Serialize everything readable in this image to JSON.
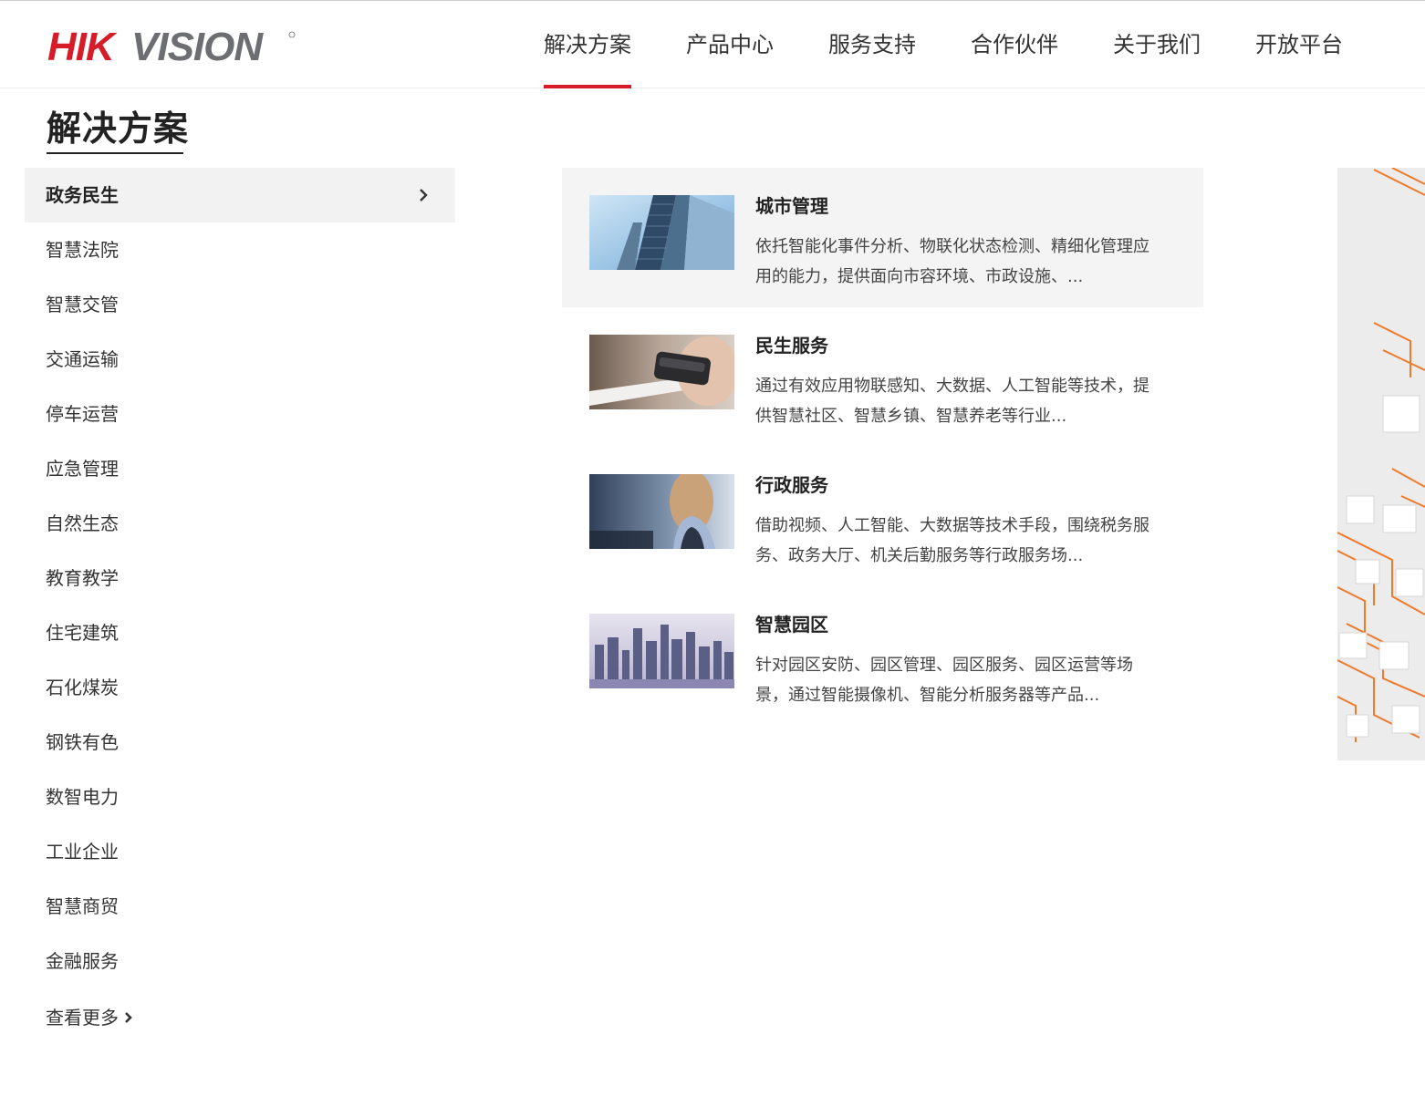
{
  "brand": {
    "name": "HIKVISION",
    "accent": "#d71c29",
    "grey": "#6d6e71"
  },
  "nav": [
    {
      "label": "解决方案",
      "active": true
    },
    {
      "label": "产品中心"
    },
    {
      "label": "服务支持"
    },
    {
      "label": "合作伙伴"
    },
    {
      "label": "关于我们"
    },
    {
      "label": "开放平台"
    }
  ],
  "section": {
    "title": "解决方案"
  },
  "menu": {
    "items": [
      {
        "label": "政务民生",
        "active": true,
        "icon": "chevron-right-icon"
      },
      {
        "label": "智慧法院"
      },
      {
        "label": "智慧交管"
      },
      {
        "label": "交通运输"
      },
      {
        "label": "停车运营"
      },
      {
        "label": "应急管理"
      },
      {
        "label": "自然生态"
      },
      {
        "label": "教育教学"
      },
      {
        "label": "住宅建筑"
      },
      {
        "label": "石化煤炭"
      },
      {
        "label": "钢铁有色"
      },
      {
        "label": "数智电力"
      },
      {
        "label": "工业企业"
      },
      {
        "label": "智慧商贸"
      },
      {
        "label": "金融服务"
      }
    ],
    "more_label": "查看更多"
  },
  "cards": [
    {
      "title": "城市管理",
      "desc": "依托智能化事件分析、物联化状态检测、精细化管理应用的能力，提供面向市容环境、市政设施、...",
      "active": true
    },
    {
      "title": "民生服务",
      "desc": "通过有效应用物联感知、大数据、人工智能等技术，提供智慧社区、智慧乡镇、智慧养老等行业..."
    },
    {
      "title": "行政服务",
      "desc": "借助视频、人工智能、大数据等技术手段，围绕税务服务、政务大厅、机关后勤服务等行政服务场..."
    },
    {
      "title": "智慧园区",
      "desc": "针对园区安防、园区管理、园区服务、园区运营等场景，通过智能摄像机、智能分析服务器等产品..."
    }
  ]
}
